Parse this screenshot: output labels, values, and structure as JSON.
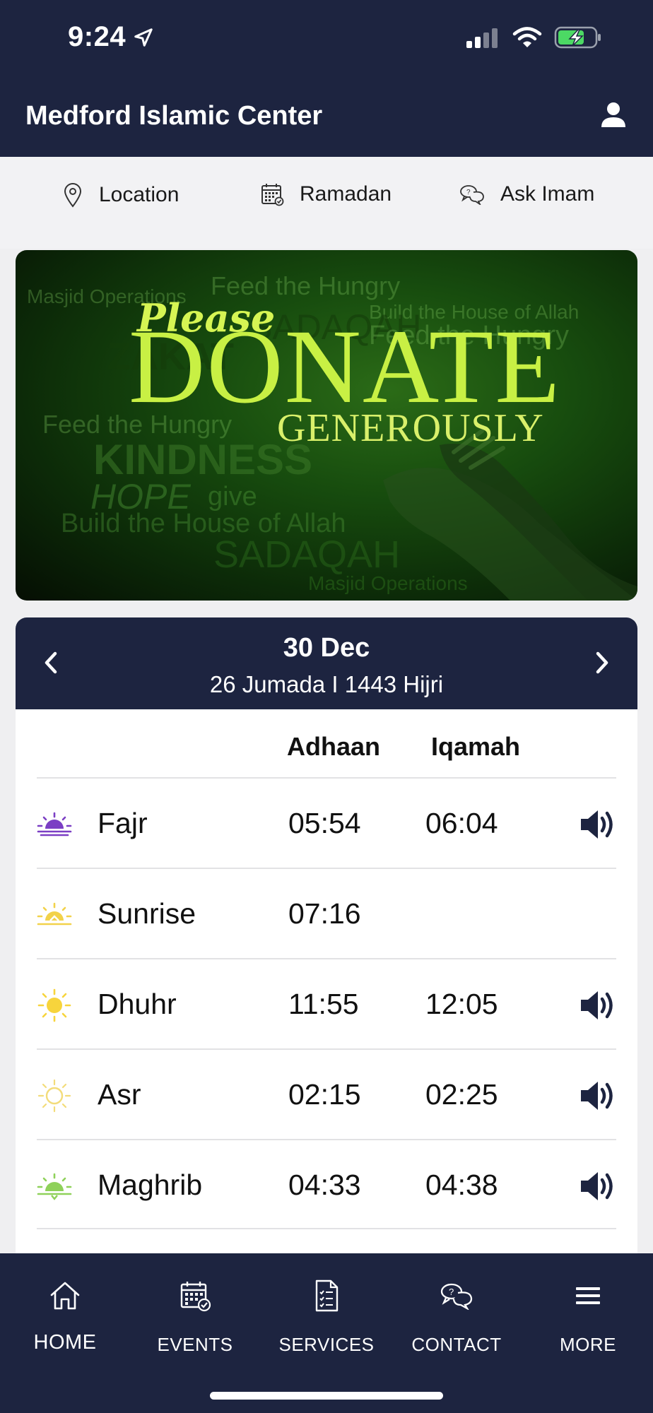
{
  "status_bar": {
    "time": "9:24"
  },
  "header": {
    "title": "Medford Islamic Center"
  },
  "quick_links": [
    {
      "label": "Location",
      "icon": "location-pin-icon"
    },
    {
      "label": "Ramadan",
      "icon": "calendar-icon"
    },
    {
      "label": "Ask Imam",
      "icon": "chat-bubbles-icon"
    }
  ],
  "banner": {
    "please": "Please",
    "donate": "DONATE",
    "generously": "GENEROUSLY",
    "background_words": [
      "Masjid Operations",
      "Feed the Hungry",
      "Build the House of Allah",
      "ZAKAT",
      "SADAQAH",
      "Feed the Hungry",
      "KINDNESS",
      "HOPE",
      "give",
      "Build the House of Allah",
      "SADAQAH",
      "Masjid Operations"
    ]
  },
  "prayer_card": {
    "date": "30 Dec",
    "hijri": "26 Jumada I 1443 Hijri",
    "col_adhaan": "Adhaan",
    "col_iqamah": "Iqamah",
    "rows": [
      {
        "name": "Fajr",
        "adhaan": "05:54",
        "iqamah": "06:04",
        "icon": "fajr-dawn-icon",
        "color": "#7b3fc4",
        "sound": true
      },
      {
        "name": "Sunrise",
        "adhaan": "07:16",
        "iqamah": "",
        "icon": "sunrise-icon",
        "color": "#f2d24a",
        "sound": false
      },
      {
        "name": "Dhuhr",
        "adhaan": "11:55",
        "iqamah": "12:05",
        "icon": "sun-icon",
        "color": "#f7d43c",
        "sound": true
      },
      {
        "name": "Asr",
        "adhaan": "02:15",
        "iqamah": "02:25",
        "icon": "sun-outline-icon",
        "color": "#f3dc7a",
        "sound": true
      },
      {
        "name": "Maghrib",
        "adhaan": "04:33",
        "iqamah": "04:38",
        "icon": "sunset-icon",
        "color": "#8fd15a",
        "sound": true
      }
    ]
  },
  "tabbar": [
    {
      "label": "HOME",
      "icon": "home-icon",
      "active": true
    },
    {
      "label": "EVENTS",
      "icon": "calendar-check-icon",
      "active": false
    },
    {
      "label": "SERVICES",
      "icon": "checklist-icon",
      "active": false
    },
    {
      "label": "CONTACT",
      "icon": "chat-bubbles-icon",
      "active": false
    },
    {
      "label": "MORE",
      "icon": "menu-icon",
      "active": false
    }
  ],
  "colors": {
    "navy": "#1d2440",
    "accent_green": "#c8f044"
  }
}
